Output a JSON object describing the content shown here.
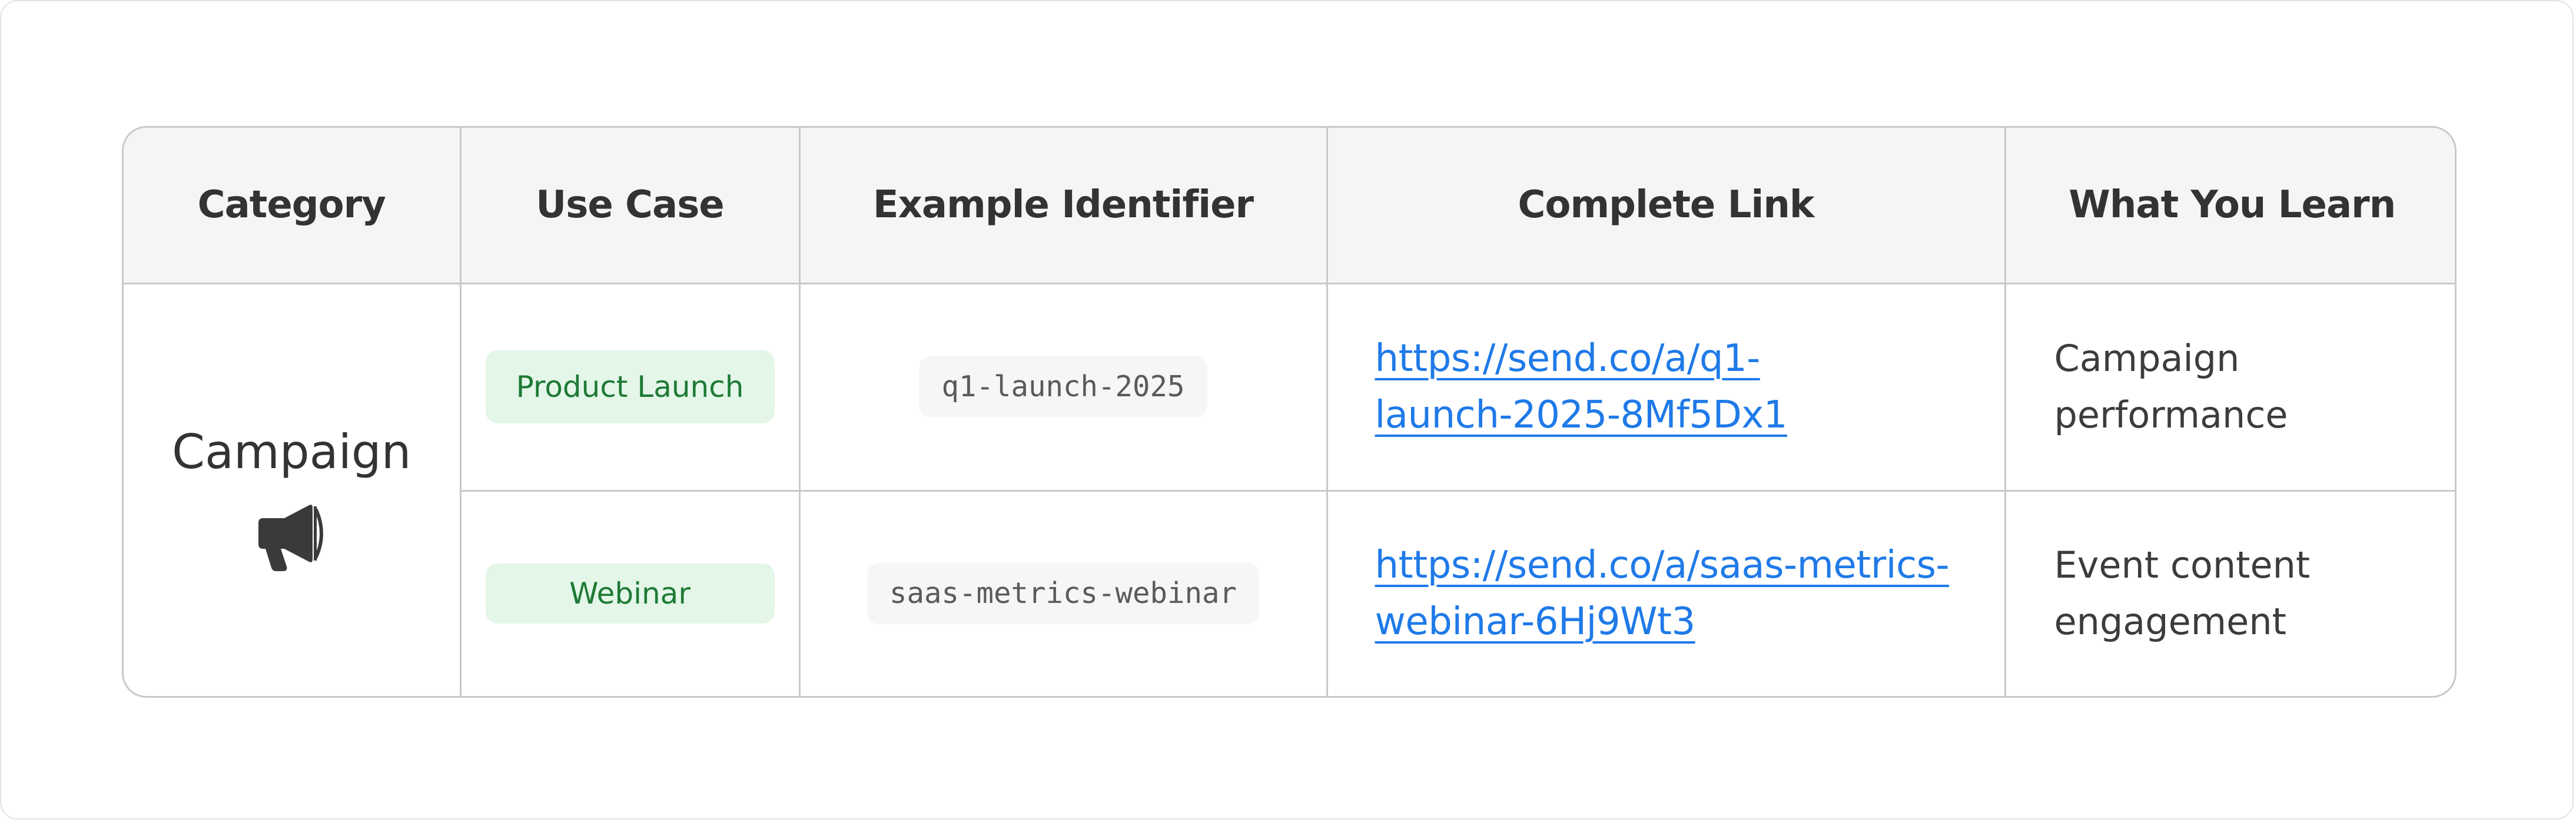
{
  "table": {
    "headers": [
      "Category",
      "Use Case",
      "Example Identifier",
      "Complete Link",
      "What You Learn"
    ],
    "category": {
      "label": "Campaign",
      "icon": "megaphone-icon"
    },
    "rows": [
      {
        "use_case": "Product Launch",
        "identifier": "q1-launch-2025",
        "link_line1": "https://send.co/a/q1-",
        "link_line2": "launch-2025-8Mf5Dx1",
        "learn_line1": "Campaign",
        "learn_line2": "performance"
      },
      {
        "use_case": "Webinar",
        "identifier": "saas-metrics-webinar",
        "link_line1": "https://send.co/a/saas-metrics-",
        "link_line2": "webinar-6Hj9Wt3",
        "learn_line1": "Event content",
        "learn_line2": "engagement"
      }
    ]
  },
  "colors": {
    "header_bg": "#f5f5f5",
    "border": "#c9c9c9",
    "pill_bg": "#e3f6e8",
    "pill_text": "#1d7a34",
    "link": "#1f7ae8",
    "text": "#333333"
  }
}
